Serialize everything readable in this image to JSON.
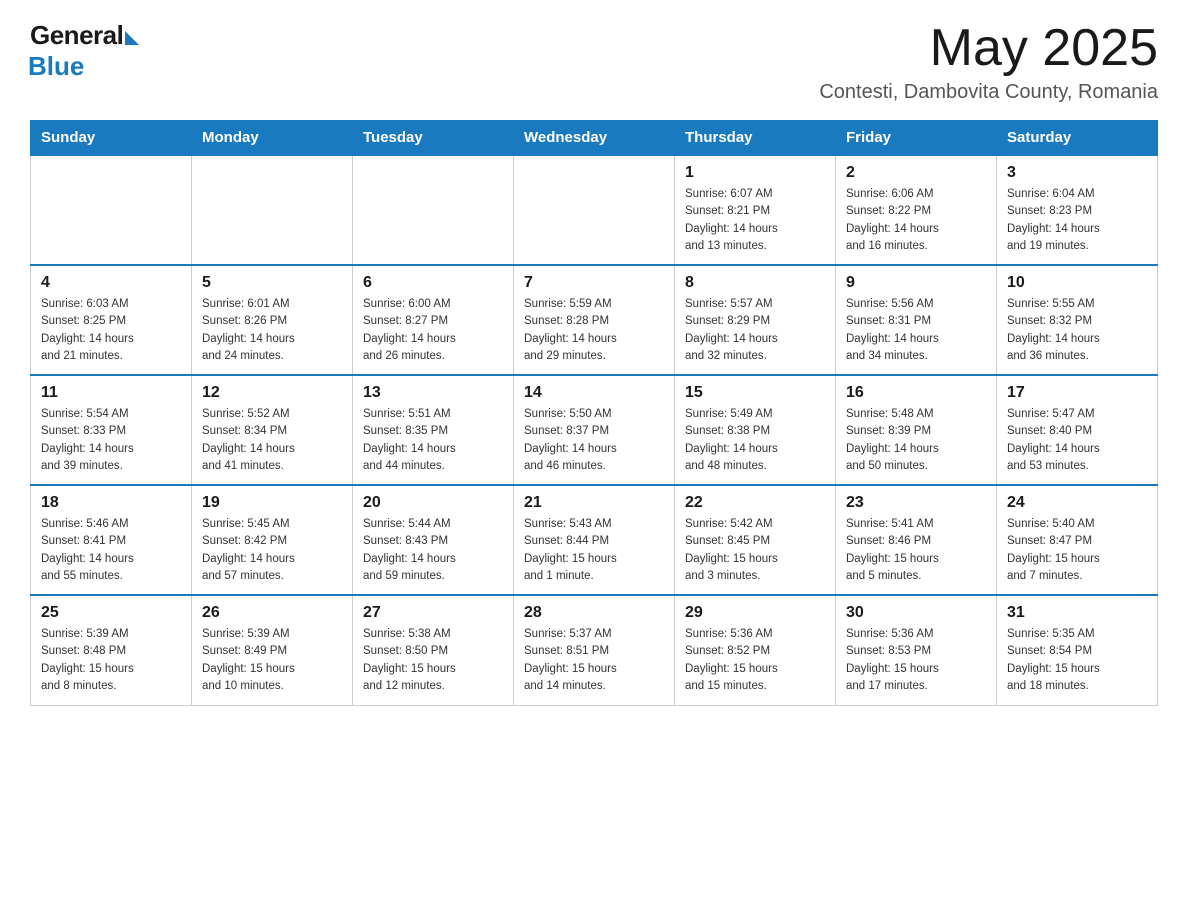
{
  "header": {
    "logo_general": "General",
    "logo_blue": "Blue",
    "month_year": "May 2025",
    "location": "Contesti, Dambovita County, Romania"
  },
  "days_of_week": [
    "Sunday",
    "Monday",
    "Tuesday",
    "Wednesday",
    "Thursday",
    "Friday",
    "Saturday"
  ],
  "weeks": [
    [
      {
        "day": "",
        "info": ""
      },
      {
        "day": "",
        "info": ""
      },
      {
        "day": "",
        "info": ""
      },
      {
        "day": "",
        "info": ""
      },
      {
        "day": "1",
        "info": "Sunrise: 6:07 AM\nSunset: 8:21 PM\nDaylight: 14 hours\nand 13 minutes."
      },
      {
        "day": "2",
        "info": "Sunrise: 6:06 AM\nSunset: 8:22 PM\nDaylight: 14 hours\nand 16 minutes."
      },
      {
        "day": "3",
        "info": "Sunrise: 6:04 AM\nSunset: 8:23 PM\nDaylight: 14 hours\nand 19 minutes."
      }
    ],
    [
      {
        "day": "4",
        "info": "Sunrise: 6:03 AM\nSunset: 8:25 PM\nDaylight: 14 hours\nand 21 minutes."
      },
      {
        "day": "5",
        "info": "Sunrise: 6:01 AM\nSunset: 8:26 PM\nDaylight: 14 hours\nand 24 minutes."
      },
      {
        "day": "6",
        "info": "Sunrise: 6:00 AM\nSunset: 8:27 PM\nDaylight: 14 hours\nand 26 minutes."
      },
      {
        "day": "7",
        "info": "Sunrise: 5:59 AM\nSunset: 8:28 PM\nDaylight: 14 hours\nand 29 minutes."
      },
      {
        "day": "8",
        "info": "Sunrise: 5:57 AM\nSunset: 8:29 PM\nDaylight: 14 hours\nand 32 minutes."
      },
      {
        "day": "9",
        "info": "Sunrise: 5:56 AM\nSunset: 8:31 PM\nDaylight: 14 hours\nand 34 minutes."
      },
      {
        "day": "10",
        "info": "Sunrise: 5:55 AM\nSunset: 8:32 PM\nDaylight: 14 hours\nand 36 minutes."
      }
    ],
    [
      {
        "day": "11",
        "info": "Sunrise: 5:54 AM\nSunset: 8:33 PM\nDaylight: 14 hours\nand 39 minutes."
      },
      {
        "day": "12",
        "info": "Sunrise: 5:52 AM\nSunset: 8:34 PM\nDaylight: 14 hours\nand 41 minutes."
      },
      {
        "day": "13",
        "info": "Sunrise: 5:51 AM\nSunset: 8:35 PM\nDaylight: 14 hours\nand 44 minutes."
      },
      {
        "day": "14",
        "info": "Sunrise: 5:50 AM\nSunset: 8:37 PM\nDaylight: 14 hours\nand 46 minutes."
      },
      {
        "day": "15",
        "info": "Sunrise: 5:49 AM\nSunset: 8:38 PM\nDaylight: 14 hours\nand 48 minutes."
      },
      {
        "day": "16",
        "info": "Sunrise: 5:48 AM\nSunset: 8:39 PM\nDaylight: 14 hours\nand 50 minutes."
      },
      {
        "day": "17",
        "info": "Sunrise: 5:47 AM\nSunset: 8:40 PM\nDaylight: 14 hours\nand 53 minutes."
      }
    ],
    [
      {
        "day": "18",
        "info": "Sunrise: 5:46 AM\nSunset: 8:41 PM\nDaylight: 14 hours\nand 55 minutes."
      },
      {
        "day": "19",
        "info": "Sunrise: 5:45 AM\nSunset: 8:42 PM\nDaylight: 14 hours\nand 57 minutes."
      },
      {
        "day": "20",
        "info": "Sunrise: 5:44 AM\nSunset: 8:43 PM\nDaylight: 14 hours\nand 59 minutes."
      },
      {
        "day": "21",
        "info": "Sunrise: 5:43 AM\nSunset: 8:44 PM\nDaylight: 15 hours\nand 1 minute."
      },
      {
        "day": "22",
        "info": "Sunrise: 5:42 AM\nSunset: 8:45 PM\nDaylight: 15 hours\nand 3 minutes."
      },
      {
        "day": "23",
        "info": "Sunrise: 5:41 AM\nSunset: 8:46 PM\nDaylight: 15 hours\nand 5 minutes."
      },
      {
        "day": "24",
        "info": "Sunrise: 5:40 AM\nSunset: 8:47 PM\nDaylight: 15 hours\nand 7 minutes."
      }
    ],
    [
      {
        "day": "25",
        "info": "Sunrise: 5:39 AM\nSunset: 8:48 PM\nDaylight: 15 hours\nand 8 minutes."
      },
      {
        "day": "26",
        "info": "Sunrise: 5:39 AM\nSunset: 8:49 PM\nDaylight: 15 hours\nand 10 minutes."
      },
      {
        "day": "27",
        "info": "Sunrise: 5:38 AM\nSunset: 8:50 PM\nDaylight: 15 hours\nand 12 minutes."
      },
      {
        "day": "28",
        "info": "Sunrise: 5:37 AM\nSunset: 8:51 PM\nDaylight: 15 hours\nand 14 minutes."
      },
      {
        "day": "29",
        "info": "Sunrise: 5:36 AM\nSunset: 8:52 PM\nDaylight: 15 hours\nand 15 minutes."
      },
      {
        "day": "30",
        "info": "Sunrise: 5:36 AM\nSunset: 8:53 PM\nDaylight: 15 hours\nand 17 minutes."
      },
      {
        "day": "31",
        "info": "Sunrise: 5:35 AM\nSunset: 8:54 PM\nDaylight: 15 hours\nand 18 minutes."
      }
    ]
  ]
}
